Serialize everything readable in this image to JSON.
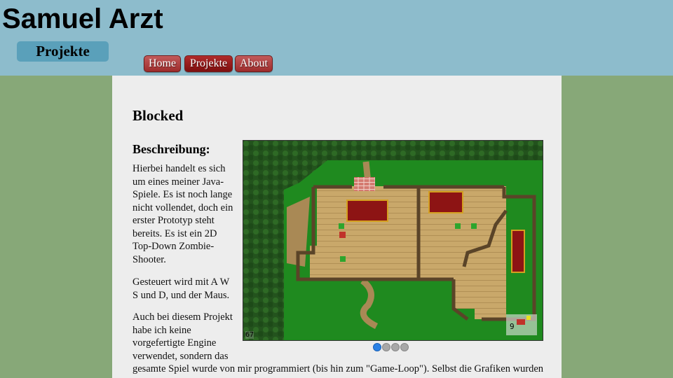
{
  "header": {
    "site_title": "Samuel Arzt",
    "section_label": "Projekte",
    "nav": [
      {
        "label": "Home",
        "active": false
      },
      {
        "label": "Projekte",
        "active": true
      },
      {
        "label": "About",
        "active": false
      }
    ]
  },
  "project": {
    "title": "Blocked",
    "description_heading": "Beschreibung:",
    "paragraphs": [
      "Hierbei handelt es sich um eines meiner Java-Spiele. Es ist noch lange nicht vollendet, doch ein erster Prototyp steht bereits. Es ist ein 2D Top-Down Zombie-Shooter.",
      "Gesteuert wird mit A W S und D, und der Maus.",
      "Auch bei diesem Projekt habe ich keine vorgefertigte Engine verwendet, sondern das",
      "gesamte Spiel wurde von mir programmiert (bis hin zum \"Game-Loop\"). Selbst die Grafiken wurden"
    ],
    "screenshot": {
      "fps": "67",
      "ammo": "9"
    },
    "slider": {
      "dot_count": 4,
      "active_index": 0,
      "active_color": "#2b82e6"
    }
  },
  "colors": {
    "page_bg": "#87a878",
    "header_bg": "#8dbccc",
    "badge_bg": "#5aa0ba",
    "nav_button": "#9e2c2c",
    "content_bg": "#ededed"
  }
}
